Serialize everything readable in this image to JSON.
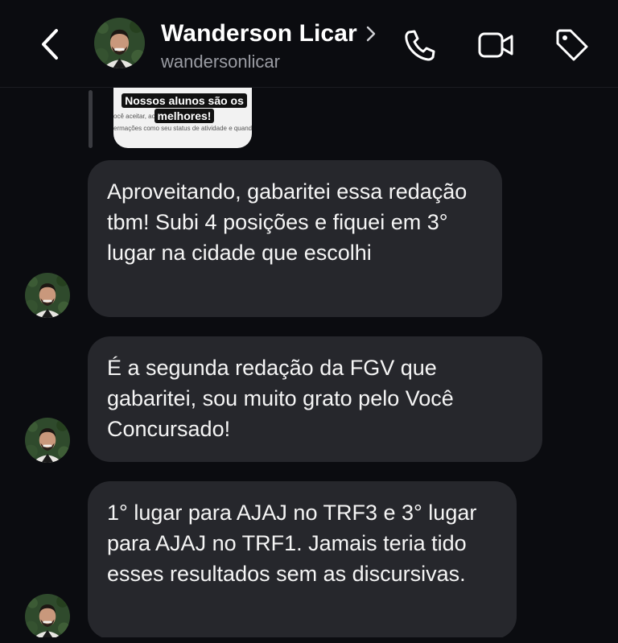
{
  "header": {
    "contact_name": "Wanderson Licar",
    "handle": "wandersonlicar",
    "icons": [
      "back-arrow-icon",
      "chevron-right-icon",
      "phone-icon",
      "video-camera-icon",
      "tag-icon"
    ]
  },
  "shared_post": {
    "caption_line1": "Nossos alunos são os",
    "caption_line2": "melhores!",
    "snippet_line1": "ocê aceitar, ao          ligar para v",
    "snippet_line2": "ermações como seu status de atividade e quando v"
  },
  "messages": [
    {
      "text": "Aproveitando, gabaritei essa redação tbm! Subi 4 posições e fiquei em 3° lugar na cidade que escolhi"
    },
    {
      "text": "É a segunda redação da FGV que gabaritei, sou muito grato pelo Você Concursado!"
    },
    {
      "text": "1° lugar para AJAJ no TRF3 e 3° lugar para AJAJ no TRF1. Jamais teria tido esses resultados sem as discursivas."
    }
  ],
  "colors": {
    "background": "#0b0c10",
    "bubble": "#26272c",
    "secondary_text": "#9a9ca3"
  }
}
